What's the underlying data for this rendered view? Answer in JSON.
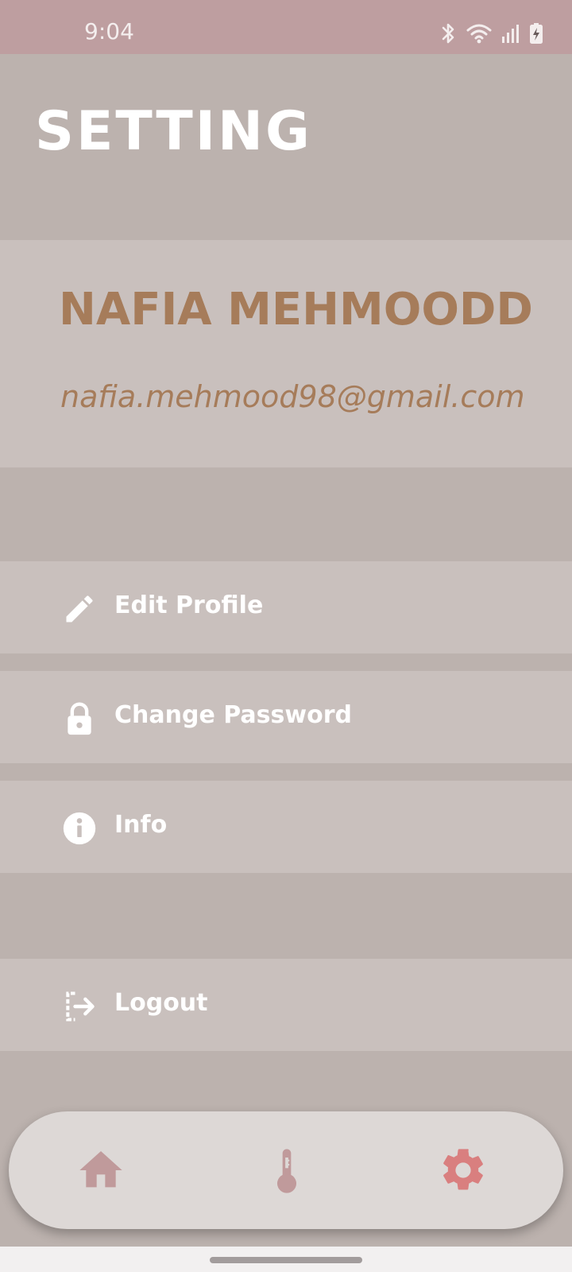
{
  "status_bar": {
    "time": "9:04",
    "icons": [
      "bluetooth-icon",
      "wifi-icon",
      "signal-icon",
      "battery-charging-icon"
    ]
  },
  "header": {
    "title": "SETTING"
  },
  "profile": {
    "name": "NAFIA MEHMOODD",
    "email": "nafia.mehmood98@gmail.com"
  },
  "menu": {
    "items": [
      {
        "label": "Edit Profile",
        "icon": "pencil-icon"
      },
      {
        "label": "Change Password",
        "icon": "lock-icon"
      },
      {
        "label": "Info",
        "icon": "info-icon"
      },
      {
        "label": "Logout",
        "icon": "logout-icon"
      }
    ]
  },
  "bottom_nav": {
    "items": [
      {
        "icon": "home-icon",
        "active": false
      },
      {
        "icon": "thermometer-icon",
        "active": false
      },
      {
        "icon": "gear-icon",
        "active": true
      }
    ]
  },
  "colors": {
    "status_bar": "#be9ea0",
    "background": "#bcb2ae",
    "card": "#c9c0bd",
    "accent_text": "#a67c5a",
    "nav_inactive": "#c09a9b",
    "nav_active": "#d97f7f"
  }
}
